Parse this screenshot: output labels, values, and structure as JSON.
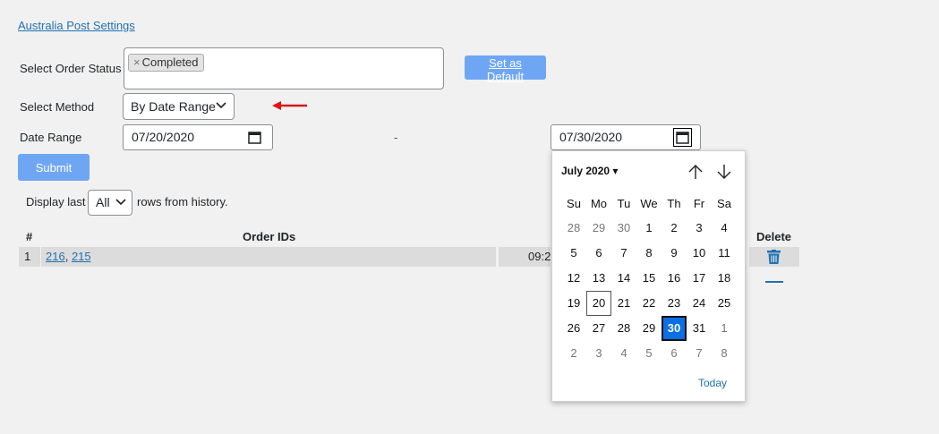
{
  "settings_link": "Australia Post Settings",
  "form": {
    "status_label": "Select Order Status",
    "status_chip": "Completed",
    "status_chip_remove": "×",
    "set_default_label": "Set as Default",
    "method_label": "Select Method",
    "method_value": "By Date Range",
    "range_label": "Date Range",
    "date_from": "07/20/2020",
    "range_separator": "-",
    "date_to": "07/30/2020",
    "submit_label": "Submit"
  },
  "history": {
    "display_prefix": "Display last",
    "rows_value": "All",
    "display_suffix": "rows from history."
  },
  "table": {
    "headers": {
      "num": "#",
      "orders": "Order IDs",
      "delete": "Delete"
    },
    "rows": [
      {
        "num": "1",
        "id1": "216",
        "id2": "215",
        "time": "09:2"
      }
    ]
  },
  "datepicker": {
    "month": "July 2020",
    "weekdays": [
      "Su",
      "Mo",
      "Tu",
      "We",
      "Th",
      "Fr",
      "Sa"
    ],
    "weeks": [
      [
        "28",
        "29",
        "30",
        "1",
        "2",
        "3",
        "4"
      ],
      [
        "5",
        "6",
        "7",
        "8",
        "9",
        "10",
        "11"
      ],
      [
        "12",
        "13",
        "14",
        "15",
        "16",
        "17",
        "18"
      ],
      [
        "19",
        "20",
        "21",
        "22",
        "23",
        "24",
        "25"
      ],
      [
        "26",
        "27",
        "28",
        "29",
        "30",
        "31",
        "1"
      ],
      [
        "2",
        "3",
        "4",
        "5",
        "6",
        "7",
        "8"
      ]
    ],
    "today_label": "Today"
  },
  "colors": {
    "accent": "#6fa6f4",
    "link": "#2271b1",
    "selected_day": "#0a6fe5",
    "arrow": "#d9161c"
  }
}
